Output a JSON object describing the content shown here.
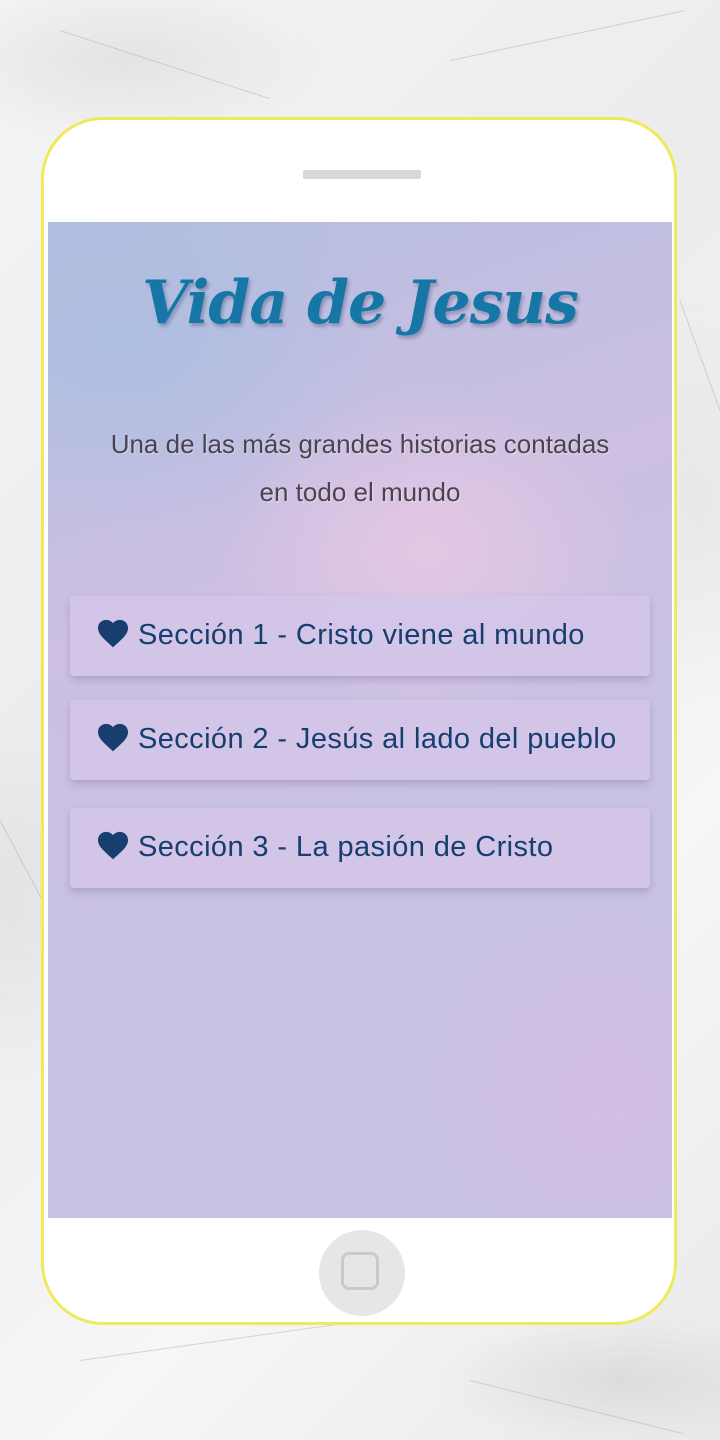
{
  "header": {
    "title": "Vida de Jesus",
    "subtitle": "Una de las más grandes historias contadas en todo el mundo"
  },
  "sections": [
    {
      "label": "Sección 1 - Cristo viene al mundo",
      "icon": "heart-icon"
    },
    {
      "label": "Sección 2 - Jesús al lado del pueblo",
      "icon": "heart-icon"
    },
    {
      "label": "Sección 3 - La pasión de Cristo",
      "icon": "heart-icon"
    }
  ],
  "colors": {
    "title": "#1677a6",
    "section_text": "#173e6e",
    "phone_frame": "#eeea5a",
    "subtitle": "#4a4350"
  }
}
